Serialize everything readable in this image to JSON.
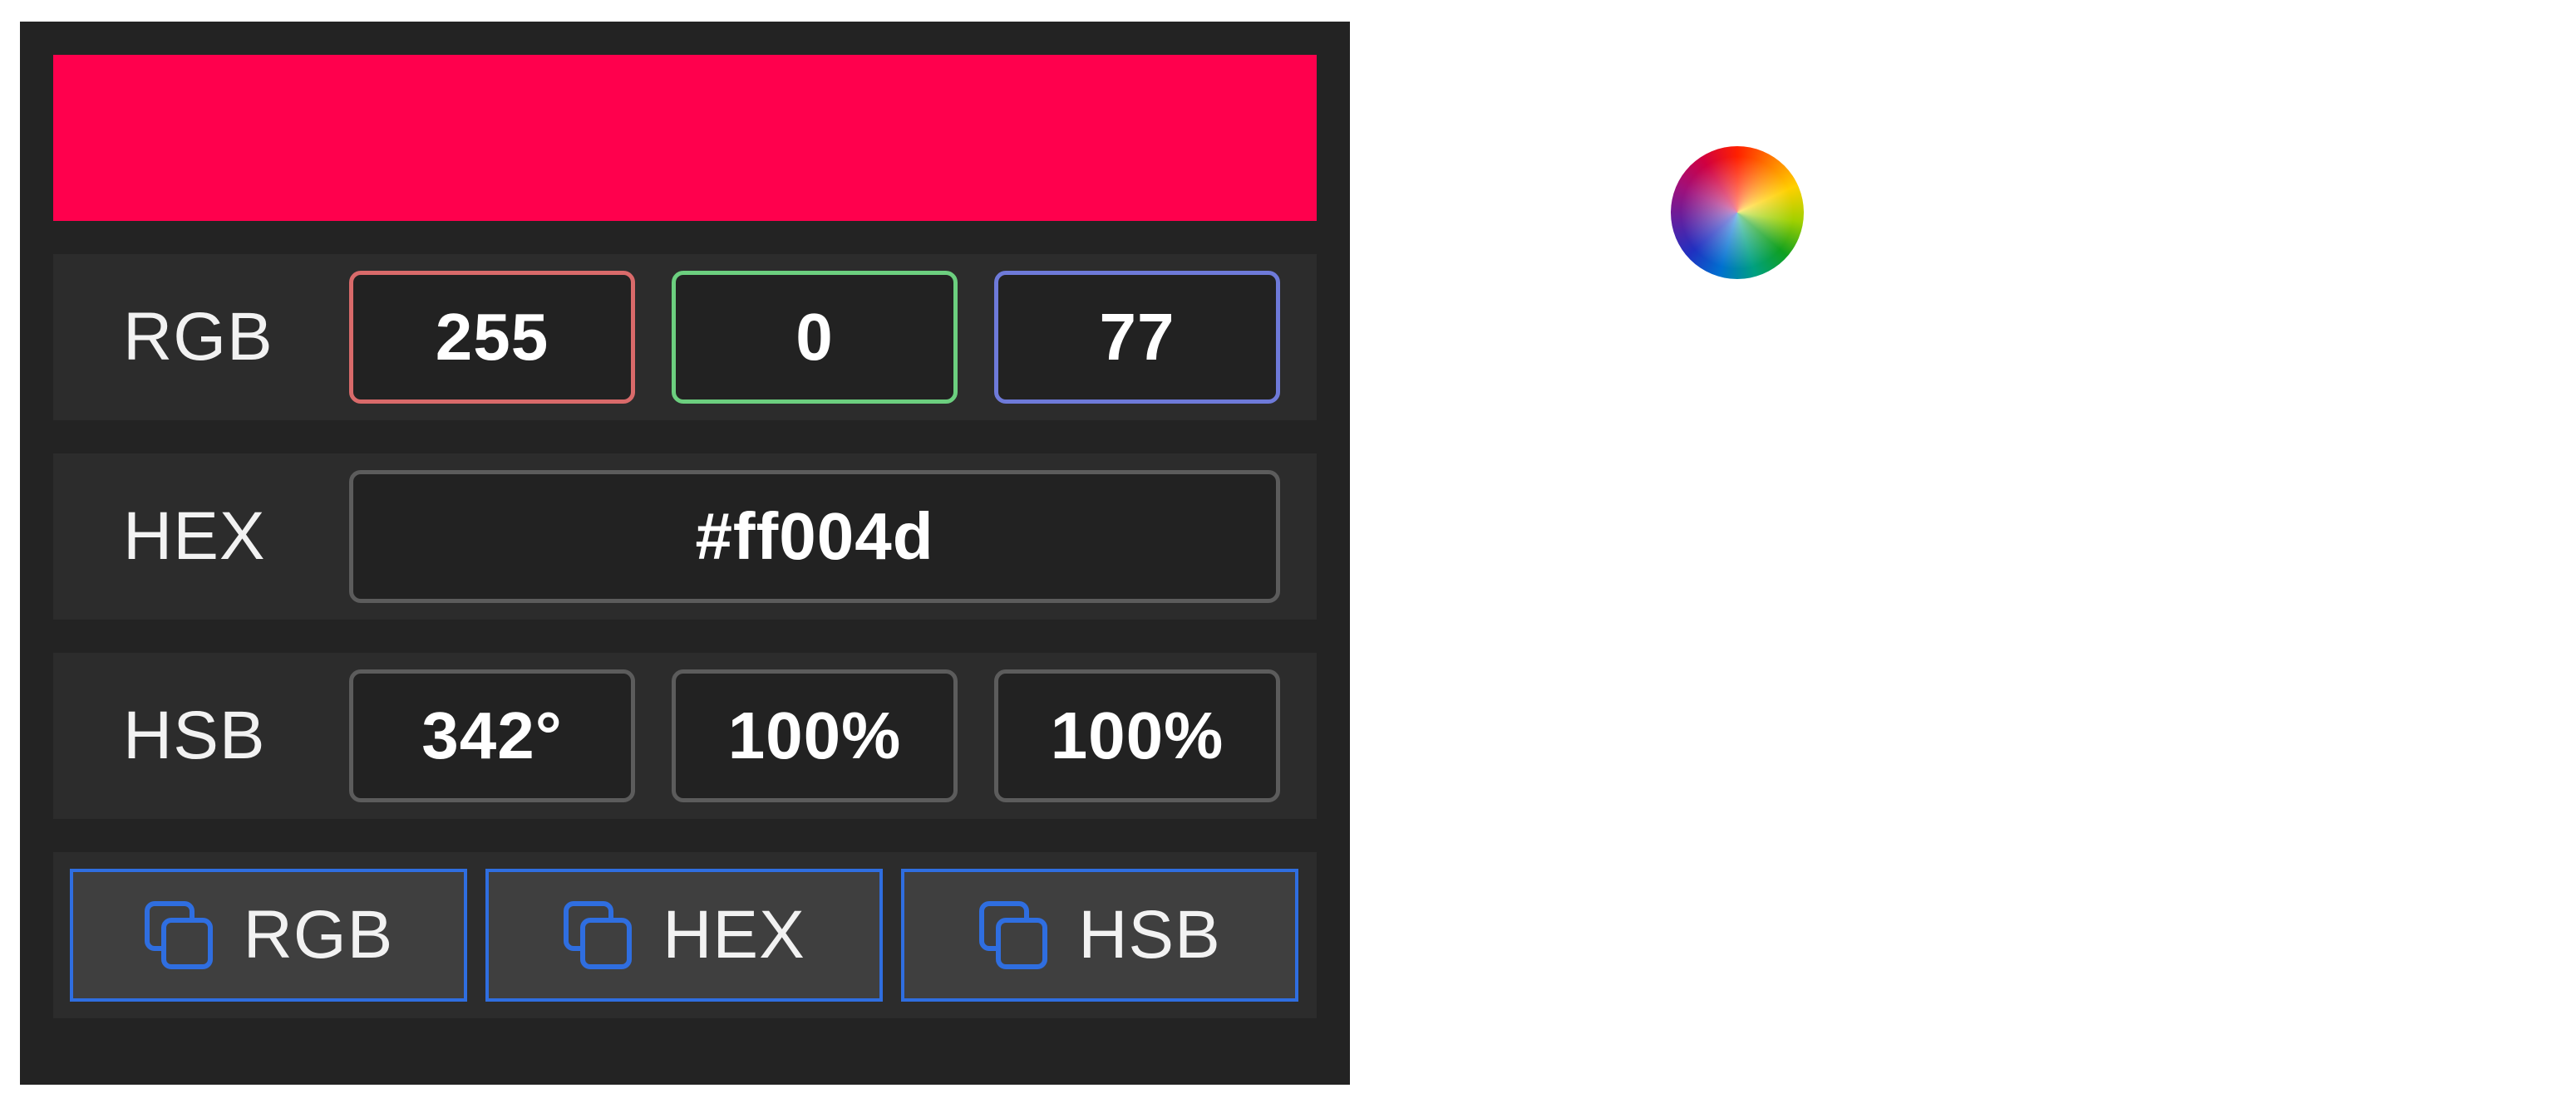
{
  "colors": {
    "current": "#ff004d",
    "red_border": "#d96a6a",
    "green_border": "#6ccf7f",
    "blue_border": "#6e7ad9",
    "neutral_border": "#5c5c5c",
    "copy_border": "#2f6ee0"
  },
  "rgb": {
    "label": "RGB",
    "r": "255",
    "g": "0",
    "b": "77"
  },
  "hex": {
    "label": "HEX",
    "value": "#ff004d"
  },
  "hsb": {
    "label": "HSB",
    "h": "342°",
    "s": "100%",
    "b": "100%"
  },
  "copy_buttons": [
    {
      "label": "RGB",
      "icon": "copy-icon"
    },
    {
      "label": "HEX",
      "icon": "copy-icon"
    },
    {
      "label": "HSB",
      "icon": "copy-icon"
    }
  ],
  "color_wheel_icon": "color-wheel-icon"
}
